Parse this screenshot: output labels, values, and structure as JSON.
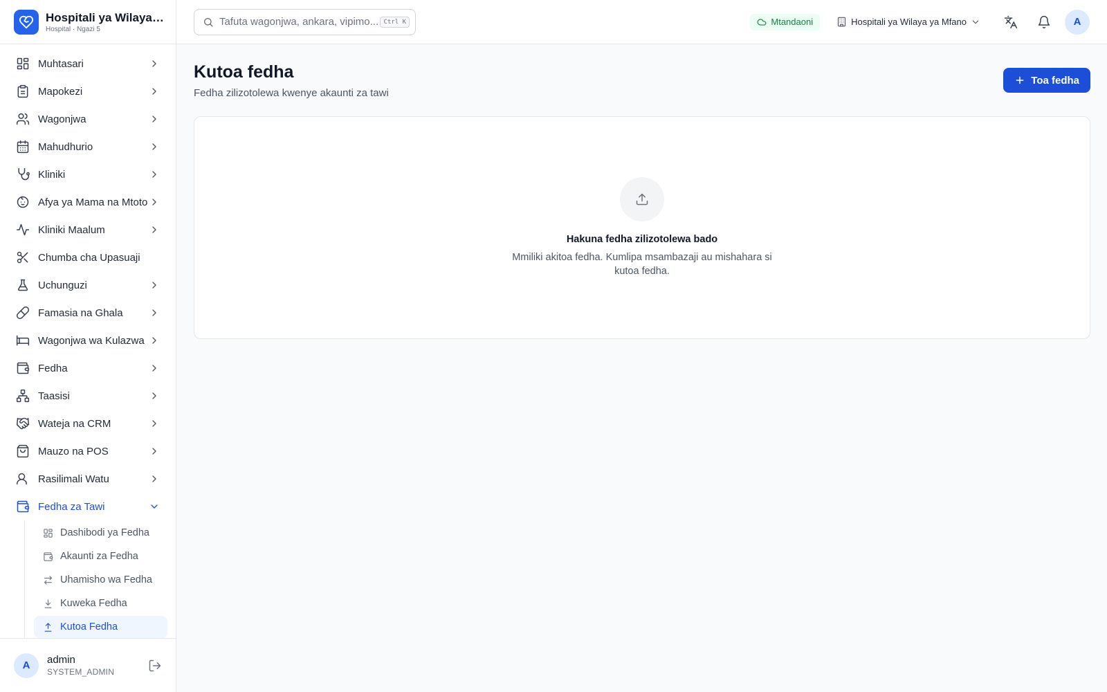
{
  "brand": {
    "name": "Hospitali ya Wilaya ya Mfano",
    "subtitle": "Hospital · Ngazi 5"
  },
  "nav": {
    "items": [
      {
        "label": "Muhtasari",
        "icon": "dashboard-icon"
      },
      {
        "label": "Mapokezi",
        "icon": "clipboard-icon"
      },
      {
        "label": "Wagonjwa",
        "icon": "users-icon"
      },
      {
        "label": "Mahudhurio",
        "icon": "calendar-icon"
      },
      {
        "label": "Kliniki",
        "icon": "stethoscope-icon"
      },
      {
        "label": "Afya ya Mama na Mtoto",
        "icon": "baby-icon"
      },
      {
        "label": "Kliniki Maalum",
        "icon": "activity-icon"
      },
      {
        "label": "Chumba cha Upasuaji",
        "icon": "scissors-icon"
      },
      {
        "label": "Uchunguzi",
        "icon": "flask-icon"
      },
      {
        "label": "Famasia na Ghala",
        "icon": "pill-icon"
      },
      {
        "label": "Wagonjwa wa Kulazwa",
        "icon": "bed-icon"
      },
      {
        "label": "Fedha",
        "icon": "wallet-icon"
      },
      {
        "label": "Taasisi",
        "icon": "network-icon"
      },
      {
        "label": "Wateja na CRM",
        "icon": "handshake-icon"
      },
      {
        "label": "Mauzo na POS",
        "icon": "shopping-bag-icon"
      },
      {
        "label": "Rasilimali Watu",
        "icon": "user-group-icon"
      },
      {
        "label": "Fedha za Tawi",
        "icon": "wallet-icon",
        "expanded": true
      }
    ],
    "sub_items": [
      {
        "label": "Dashibodi ya Fedha",
        "icon": "dashboard-icon"
      },
      {
        "label": "Akaunti za Fedha",
        "icon": "wallet-icon"
      },
      {
        "label": "Uhamisho wa Fedha",
        "icon": "transfer-icon"
      },
      {
        "label": "Kuweka Fedha",
        "icon": "download-icon"
      },
      {
        "label": "Kutoa Fedha",
        "icon": "upload-icon",
        "active": true
      }
    ]
  },
  "user": {
    "initial": "A",
    "name": "admin",
    "role": "SYSTEM_ADMIN"
  },
  "topbar": {
    "search_placeholder": "Tafuta wagonjwa, ankara, vipimo...",
    "search_shortcut": "Ctrl K",
    "status": "Mtandaoni",
    "branch": "Hospitali ya Wilaya ya Mfano",
    "avatar_initial": "A"
  },
  "page": {
    "title": "Kutoa fedha",
    "subtitle": "Fedha zilizotolewa kwenye akaunti za tawi",
    "primary_action": "Toa fedha"
  },
  "empty_state": {
    "icon": "upload-icon",
    "title": "Hakuna fedha zilizotolewa bado",
    "description": "Mmiliki akitoa fedha. Kumlipa msambazaji au mishahara si kutoa fedha."
  },
  "colors": {
    "accent": "#1d4ed8",
    "online_bg": "#ecfdf5",
    "online_text": "#15803d",
    "active_bg": "#eff6ff"
  }
}
